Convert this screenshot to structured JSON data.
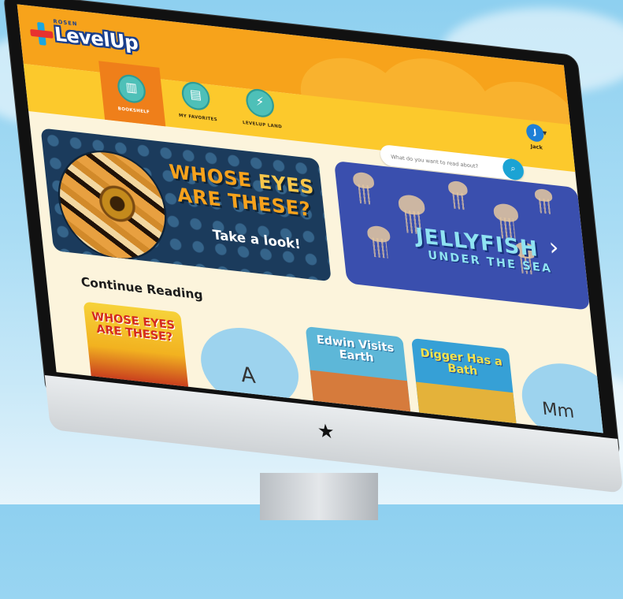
{
  "app": {
    "logo_small": "ROSEN",
    "logo_text": "LevelUp"
  },
  "nav": {
    "tabs": [
      {
        "label": "BOOKSHELF",
        "icon": "bookshelf-icon",
        "active": true
      },
      {
        "label": "MY FAVORITES",
        "icon": "favorites-book-icon",
        "active": false
      },
      {
        "label": "LEVELUP LAND",
        "icon": "lightning-icon",
        "active": false
      }
    ]
  },
  "user": {
    "initial": "J",
    "name": "Jack"
  },
  "search": {
    "placeholder": "What do you want to read about?"
  },
  "banners": [
    {
      "title_part1": "WHOSE ",
      "title_highlight": "EYES",
      "title_part2": "ARE THESE?",
      "cta": "Take a look!"
    },
    {
      "title": "JELLYFISH",
      "subtitle": "UNDER THE SEA"
    }
  ],
  "continue_reading": {
    "heading": "Continue Reading",
    "books": [
      {
        "cover_text": "WHOSE EYES ARE THESE?"
      },
      {
        "cover_text": "A"
      },
      {
        "cover_text": "Edwin Visits Earth"
      },
      {
        "cover_text": "Digger Has a Bath"
      },
      {
        "cover_text": "Mm"
      }
    ]
  },
  "colors": {
    "header_orange": "#f7a31b",
    "nav_yellow": "#fcc92c",
    "active_tab": "#ef7f1a",
    "page_bg": "#fcf4dc",
    "accent_blue": "#1ba3d4"
  }
}
